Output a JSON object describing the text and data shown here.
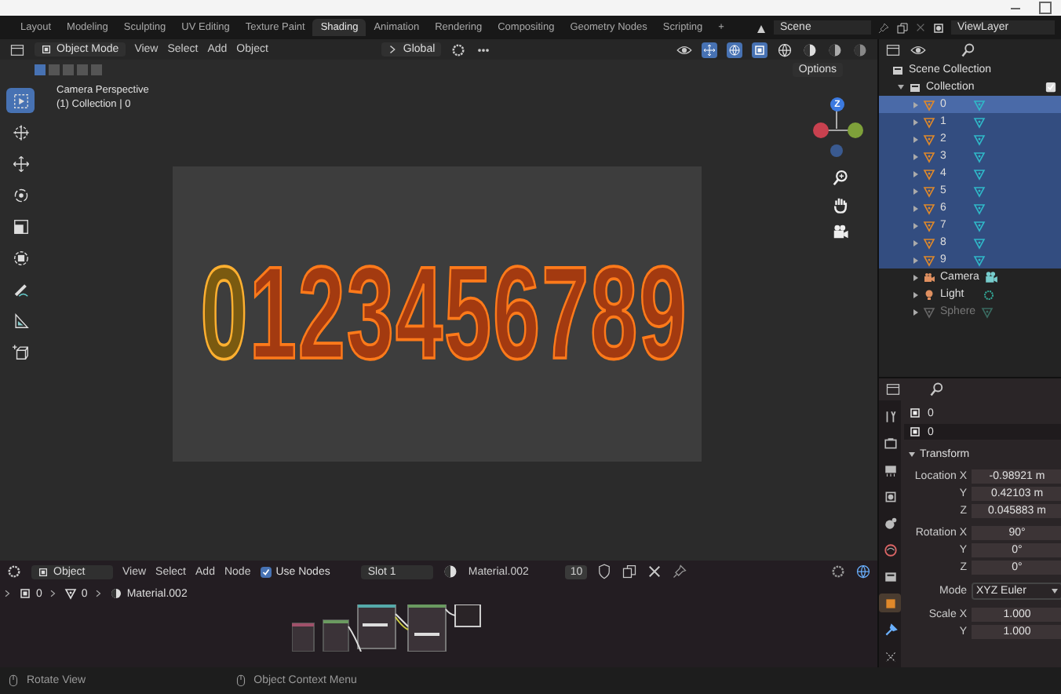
{
  "workspace_tabs": [
    {
      "label": "Layout",
      "selected": false
    },
    {
      "label": "Modeling",
      "selected": false
    },
    {
      "label": "Sculpting",
      "selected": false
    },
    {
      "label": "UV Editing",
      "selected": false
    },
    {
      "label": "Texture Paint",
      "selected": false
    },
    {
      "label": "Shading",
      "selected": true
    },
    {
      "label": "Animation",
      "selected": false
    },
    {
      "label": "Rendering",
      "selected": false
    },
    {
      "label": "Compositing",
      "selected": false
    },
    {
      "label": "Geometry Nodes",
      "selected": false
    },
    {
      "label": "Scripting",
      "selected": false
    },
    {
      "label": "+",
      "selected": false
    }
  ],
  "scene": "Scene",
  "view_layer": "ViewLayer",
  "viewport": {
    "mode": "Object Mode",
    "menus": [
      "View",
      "Select",
      "Add",
      "Object"
    ],
    "orientation": "Global",
    "options": "Options",
    "view_name": "Camera Perspective",
    "collection_info": "(1) Collection | 0",
    "gizmo_axis": "Z",
    "tools": [
      {
        "kind": "select",
        "selected": true
      },
      {
        "kind": "cursor",
        "selected": false
      },
      {
        "kind": "move",
        "selected": false
      },
      {
        "kind": "rotate",
        "selected": false
      },
      {
        "kind": "scale",
        "selected": false
      },
      {
        "kind": "transform",
        "selected": false
      },
      {
        "kind": "annotate",
        "selected": false
      },
      {
        "kind": "measure",
        "selected": false
      },
      {
        "kind": "add-cube",
        "selected": false
      }
    ],
    "objects": [
      {
        "label": "0",
        "active": true
      },
      {
        "label": "1",
        "active": false
      },
      {
        "label": "2",
        "active": false
      },
      {
        "label": "3",
        "active": false
      },
      {
        "label": "4",
        "active": false
      },
      {
        "label": "5",
        "active": false
      },
      {
        "label": "6",
        "active": false
      },
      {
        "label": "7",
        "active": false
      },
      {
        "label": "8",
        "active": false
      },
      {
        "label": "9",
        "active": false
      }
    ]
  },
  "outliner": {
    "root": "Scene Collection",
    "collection": {
      "name": "Collection",
      "checked": true,
      "expanded": true,
      "children": [
        {
          "name": "0",
          "kind": "mesh",
          "selected": true
        },
        {
          "name": "1",
          "kind": "mesh",
          "selected": true
        },
        {
          "name": "2",
          "kind": "mesh",
          "selected": true
        },
        {
          "name": "3",
          "kind": "mesh",
          "selected": true
        },
        {
          "name": "4",
          "kind": "mesh",
          "selected": true
        },
        {
          "name": "5",
          "kind": "mesh",
          "selected": true
        },
        {
          "name": "6",
          "kind": "mesh",
          "selected": true
        },
        {
          "name": "7",
          "kind": "mesh",
          "selected": true
        },
        {
          "name": "8",
          "kind": "mesh",
          "selected": true
        },
        {
          "name": "9",
          "kind": "mesh",
          "selected": true
        },
        {
          "name": "Camera",
          "kind": "camera",
          "selected": false
        },
        {
          "name": "Light",
          "kind": "light",
          "selected": false
        },
        {
          "name": "Sphere",
          "kind": "hidden-mesh",
          "selected": false
        }
      ]
    }
  },
  "properties": {
    "tabs": [
      {
        "kind": "tool",
        "selected": false
      },
      {
        "kind": "render",
        "selected": false
      },
      {
        "kind": "output",
        "selected": false
      },
      {
        "kind": "view-layer",
        "selected": false
      },
      {
        "kind": "scene",
        "selected": false
      },
      {
        "kind": "world",
        "selected": false
      },
      {
        "kind": "collection",
        "selected": false
      },
      {
        "kind": "object",
        "selected": true
      },
      {
        "kind": "modifier",
        "selected": false
      },
      {
        "kind": "particles",
        "selected": false
      }
    ],
    "object_name": "0",
    "data_name": "0",
    "section": "Transform",
    "expanded": true,
    "fields": [
      {
        "label": "Location X",
        "value": "-0.98921 m",
        "kind": "number"
      },
      {
        "label": "Y",
        "value": "0.42103 m",
        "kind": "number"
      },
      {
        "label": "Z",
        "value": "0.045883 m",
        "kind": "number"
      },
      {
        "label": "Rotation X",
        "value": "90°",
        "kind": "number"
      },
      {
        "label": "Y",
        "value": "0°",
        "kind": "number"
      },
      {
        "label": "Z",
        "value": "0°",
        "kind": "number"
      },
      {
        "label": "Mode",
        "value": "XYZ Euler",
        "kind": "dropdown"
      },
      {
        "label": "Scale X",
        "value": "1.000",
        "kind": "number"
      },
      {
        "label": "Y",
        "value": "1.000",
        "kind": "number"
      }
    ]
  },
  "node_editor": {
    "type": "Object",
    "menus": [
      "View",
      "Select",
      "Add",
      "Node"
    ],
    "use_nodes": {
      "label": "Use Nodes",
      "checked": true
    },
    "slot": "Slot 1",
    "material": "Material.002",
    "users": "10",
    "breadcrumb": [
      "0",
      "0",
      "Material.002"
    ]
  },
  "status_bar": [
    "Rotate View",
    "Object Context Menu"
  ]
}
